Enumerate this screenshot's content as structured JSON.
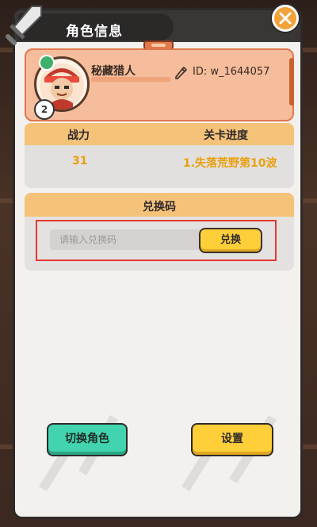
{
  "header": {
    "title": "角色信息",
    "close_icon": "close-icon"
  },
  "profile": {
    "name": "秘藏猎人",
    "id_label": "ID: w_1644057",
    "level": "2",
    "avatar_icon": "character-avatar",
    "edit_icon": "pencil-icon"
  },
  "stats": {
    "power_label": "战力",
    "progress_label": "关卡进度",
    "power_value": "31",
    "progress_value": "1.失落荒野第10波"
  },
  "redeem": {
    "title": "兑换码",
    "input_placeholder": "请输入兑换码",
    "button_label": "兑换"
  },
  "actions": {
    "switch_label": "切换角色",
    "settings_label": "设置"
  },
  "colors": {
    "accent_yellow": "#ffcf3a",
    "accent_teal": "#42d4ae",
    "highlight_red": "#e53935",
    "header_orange": "#f5c27a"
  }
}
